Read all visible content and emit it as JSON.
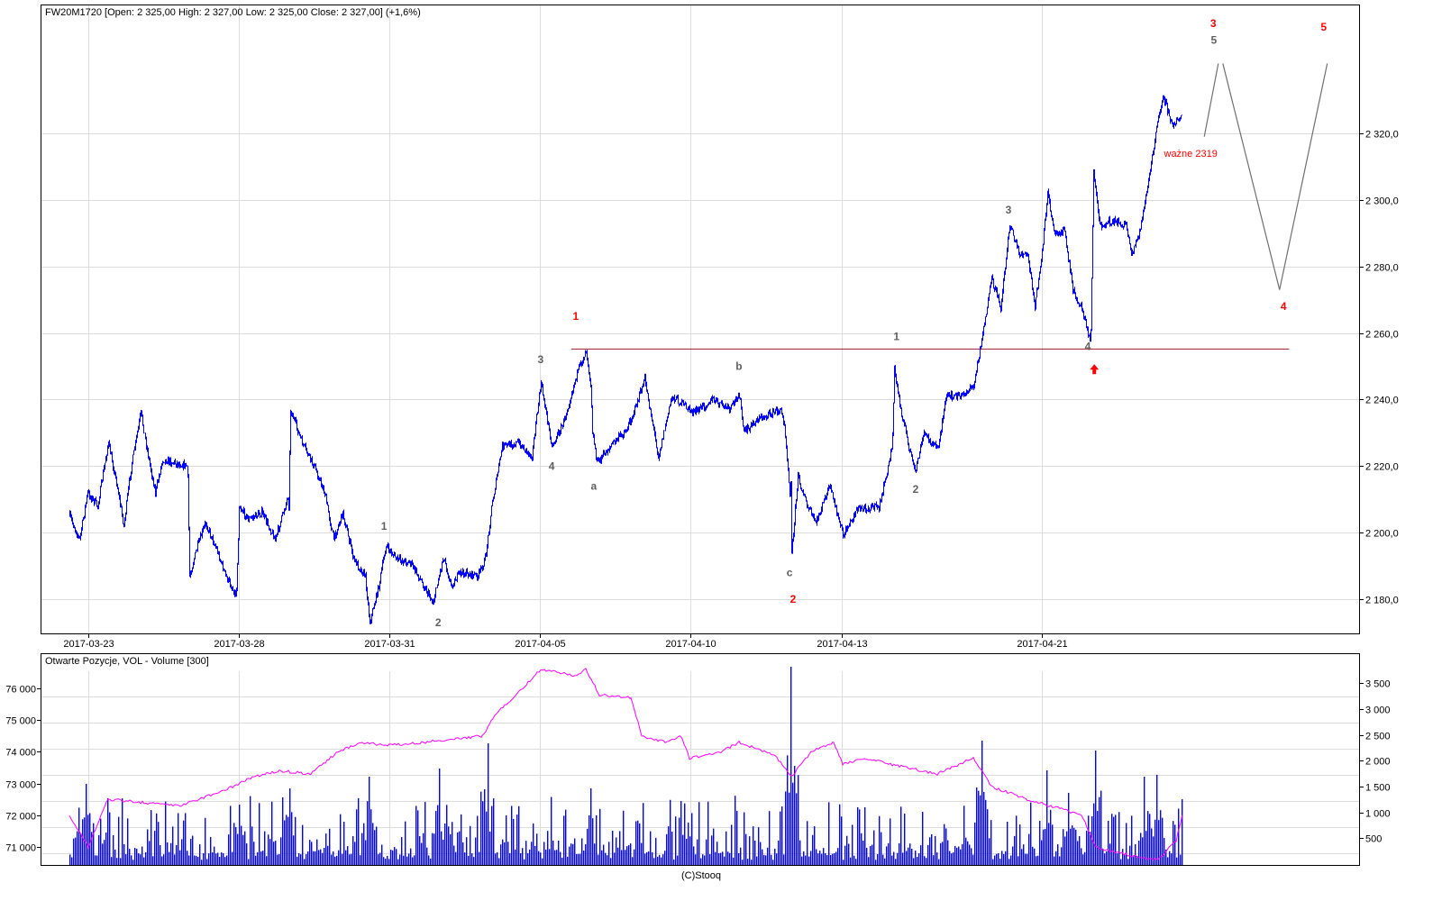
{
  "chart_data": [
    {
      "type": "line",
      "title": "FW20M1720 [Open: 2 325,00  High: 2 327,00  Low: 2 325,00  Close: 2 327,00] (+1,6%)",
      "x_unit": "trading days since 2017-03-23",
      "x_ticks": [
        {
          "d": 0,
          "label": "2017-03-23"
        },
        {
          "d": 3,
          "label": "2017-03-28"
        },
        {
          "d": 6,
          "label": "2017-03-31"
        },
        {
          "d": 9,
          "label": "2017-04-05"
        },
        {
          "d": 12,
          "label": "2017-04-10"
        },
        {
          "d": 15,
          "label": "2017-04-13"
        },
        {
          "d": 19,
          "label": "2017-04-21"
        }
      ],
      "y_ticks": [
        {
          "v": 2180,
          "label": "2 180,0"
        },
        {
          "v": 2200,
          "label": "2 200,0"
        },
        {
          "v": 2220,
          "label": "2 220,0"
        },
        {
          "v": 2240,
          "label": "2 240,0"
        },
        {
          "v": 2260,
          "label": "2 260,0"
        },
        {
          "v": 2280,
          "label": "2 280,0"
        },
        {
          "v": 2300,
          "label": "2 300,0"
        },
        {
          "v": 2320,
          "label": "2 320,0"
        }
      ],
      "ylim": [
        2169,
        2364
      ],
      "xlim": [
        -0.8,
        25.4
      ],
      "grid": true,
      "price_color": "#0000ff",
      "series": [
        {
          "name": "FW20M1720",
          "points": [
            [
              -0.38,
              2205
            ],
            [
              -0.18,
              2198
            ],
            [
              -0.02,
              2212
            ],
            [
              0.18,
              2208
            ],
            [
              0.39,
              2227
            ],
            [
              0.57,
              2214
            ],
            [
              0.7,
              2202
            ],
            [
              0.84,
              2219
            ],
            [
              1.04,
              2236
            ],
            [
              1.2,
              2222
            ],
            [
              1.33,
              2212
            ],
            [
              1.47,
              2222
            ],
            [
              1.97,
              2220
            ],
            [
              2.01,
              2187
            ],
            [
              2.15,
              2195
            ],
            [
              2.33,
              2203
            ],
            [
              2.55,
              2195
            ],
            [
              2.73,
              2187
            ],
            [
              2.94,
              2181
            ],
            [
              3.0,
              2208
            ],
            [
              3.18,
              2204
            ],
            [
              3.45,
              2206
            ],
            [
              3.72,
              2198
            ],
            [
              3.99,
              2212
            ],
            [
              4.02,
              2237
            ],
            [
              4.25,
              2227
            ],
            [
              4.52,
              2219
            ],
            [
              4.7,
              2212
            ],
            [
              4.88,
              2198
            ],
            [
              5.06,
              2206
            ],
            [
              5.28,
              2192
            ],
            [
              5.51,
              2187
            ],
            [
              5.6,
              2173
            ],
            [
              5.78,
              2184
            ],
            [
              5.92,
              2196
            ],
            [
              6.14,
              2192
            ],
            [
              6.41,
              2191
            ],
            [
              6.68,
              2184
            ],
            [
              6.86,
              2179
            ],
            [
              7.07,
              2193
            ],
            [
              7.22,
              2184
            ],
            [
              7.4,
              2188
            ],
            [
              7.76,
              2187
            ],
            [
              7.9,
              2192
            ],
            [
              8.03,
              2208
            ],
            [
              8.24,
              2226
            ],
            [
              8.56,
              2227
            ],
            [
              8.83,
              2223
            ],
            [
              9.01,
              2245
            ],
            [
              9.23,
              2226
            ],
            [
              9.46,
              2233
            ],
            [
              9.69,
              2246
            ],
            [
              9.91,
              2255
            ],
            [
              10.0,
              2245
            ],
            [
              10.04,
              2230
            ],
            [
              10.13,
              2221
            ],
            [
              10.45,
              2227
            ],
            [
              10.72,
              2231
            ],
            [
              10.9,
              2238
            ],
            [
              11.08,
              2246
            ],
            [
              11.35,
              2223
            ],
            [
              11.62,
              2241
            ],
            [
              12.06,
              2236
            ],
            [
              12.42,
              2240
            ],
            [
              12.78,
              2237
            ],
            [
              12.96,
              2242
            ],
            [
              13.05,
              2230
            ],
            [
              13.32,
              2234
            ],
            [
              13.77,
              2237
            ],
            [
              13.86,
              2233
            ],
            [
              13.99,
              2208
            ],
            [
              14.0,
              2193
            ],
            [
              14.13,
              2217
            ],
            [
              14.31,
              2208
            ],
            [
              14.49,
              2203
            ],
            [
              14.76,
              2214
            ],
            [
              15.03,
              2199
            ],
            [
              15.3,
              2207
            ],
            [
              15.75,
              2208
            ],
            [
              15.92,
              2219
            ],
            [
              16.01,
              2227
            ],
            [
              16.05,
              2249
            ],
            [
              16.19,
              2236
            ],
            [
              16.46,
              2218
            ],
            [
              16.64,
              2230
            ],
            [
              16.91,
              2225
            ],
            [
              17.09,
              2241
            ],
            [
              17.36,
              2241
            ],
            [
              17.63,
              2244
            ],
            [
              17.81,
              2260
            ],
            [
              17.99,
              2276
            ],
            [
              18.17,
              2268
            ],
            [
              18.35,
              2293
            ],
            [
              18.53,
              2284
            ],
            [
              18.71,
              2283
            ],
            [
              18.85,
              2268
            ],
            [
              18.98,
              2282
            ],
            [
              19.1,
              2302
            ],
            [
              19.25,
              2290
            ],
            [
              19.43,
              2291
            ],
            [
              19.61,
              2273
            ],
            [
              19.79,
              2267
            ],
            [
              19.96,
              2257
            ],
            [
              20.02,
              2309
            ],
            [
              20.14,
              2292
            ],
            [
              20.41,
              2294
            ],
            [
              20.68,
              2292
            ],
            [
              20.77,
              2283
            ],
            [
              20.94,
              2291
            ],
            [
              21.12,
              2306
            ],
            [
              21.27,
              2321
            ],
            [
              21.4,
              2332
            ],
            [
              21.58,
              2322
            ],
            [
              21.79,
              2326
            ]
          ]
        }
      ],
      "projection": {
        "color": "#707070",
        "segments": [
          [
            [
              22.23,
              2319
            ],
            [
              22.51,
              2341
            ]
          ],
          [
            [
              22.6,
              2341
            ],
            [
              23.73,
              2273
            ]
          ],
          [
            [
              23.73,
              2273
            ],
            [
              24.68,
              2341
            ]
          ]
        ]
      },
      "resistance_line": {
        "price": 2255.3,
        "from_d": 9.62,
        "to_d": 23.92,
        "color": "#9b1c2c"
      },
      "annotations": [
        {
          "text": "1",
          "d": 9.71,
          "p": 2265,
          "color": "#ff0000"
        },
        {
          "text": "3",
          "d": 9.01,
          "p": 2252,
          "color": "#606060"
        },
        {
          "text": "4",
          "d": 9.23,
          "p": 2220,
          "color": "#606060"
        },
        {
          "text": "a",
          "d": 10.07,
          "p": 2214,
          "color": "#606060"
        },
        {
          "text": "b",
          "d": 12.96,
          "p": 2250,
          "color": "#606060"
        },
        {
          "text": "c",
          "d": 13.97,
          "p": 2188,
          "color": "#606060"
        },
        {
          "text": "2",
          "d": 14.04,
          "p": 2180,
          "color": "#ff0000"
        },
        {
          "text": "1",
          "d": 5.89,
          "p": 2202,
          "color": "#606060"
        },
        {
          "text": "2",
          "d": 6.97,
          "p": 2173,
          "color": "#606060"
        },
        {
          "text": "1",
          "d": 16.1,
          "p": 2259,
          "color": "#606060"
        },
        {
          "text": "2",
          "d": 16.48,
          "p": 2213,
          "color": "#606060"
        },
        {
          "text": "3",
          "d": 18.33,
          "p": 2297,
          "color": "#606060"
        },
        {
          "text": "4",
          "d": 19.91,
          "p": 2256,
          "color": "#606060"
        },
        {
          "text": "3",
          "d": 22.41,
          "p": 2353,
          "color": "#ff0000"
        },
        {
          "text": "5",
          "d": 22.42,
          "p": 2348,
          "color": "#606060"
        },
        {
          "text": "5",
          "d": 24.61,
          "p": 2352,
          "color": "#ff0000"
        },
        {
          "text": "4",
          "d": 23.81,
          "p": 2268,
          "color": "#ff0000"
        }
      ],
      "note": {
        "text": "ważne 2319",
        "d": 21.96,
        "p": 2314,
        "color": "#ff0000"
      },
      "arrow": {
        "icon": "arrow-up-icon",
        "d": 20.04,
        "p": 2249,
        "color": "#ff0000"
      }
    },
    {
      "type": "bar",
      "title": "Otwarte Pozycje, VOL - Volume [300]",
      "left_axis_ticks": [
        {
          "v": 71000,
          "label": "71 000"
        },
        {
          "v": 72000,
          "label": "72 000"
        },
        {
          "v": 73000,
          "label": "73 000"
        },
        {
          "v": 74000,
          "label": "74 000"
        },
        {
          "v": 75000,
          "label": "75 000"
        },
        {
          "v": 76000,
          "label": "76 000"
        }
      ],
      "right_axis_ticks": [
        {
          "v": 500,
          "label": "500"
        },
        {
          "v": 1000,
          "label": "1 000"
        },
        {
          "v": 1500,
          "label": "1 500"
        },
        {
          "v": 2000,
          "label": "2 000"
        },
        {
          "v": 2500,
          "label": "2 500"
        },
        {
          "v": 3000,
          "label": "3 000"
        },
        {
          "v": 3500,
          "label": "3 500"
        }
      ],
      "volume_color": "#0000ff",
      "oi_color": "#ff00ff",
      "open_interest": [
        [
          -0.38,
          72000
        ],
        [
          0,
          71000
        ],
        [
          0.39,
          72500
        ],
        [
          1.83,
          72300
        ],
        [
          2.73,
          72800
        ],
        [
          3.27,
          73200
        ],
        [
          3.81,
          73400
        ],
        [
          4.43,
          73300
        ],
        [
          4.97,
          74000
        ],
        [
          5.42,
          74300
        ],
        [
          5.96,
          74200
        ],
        [
          6.68,
          74300
        ],
        [
          7.22,
          74400
        ],
        [
          7.85,
          74500
        ],
        [
          8.12,
          75200
        ],
        [
          8.65,
          76000
        ],
        [
          9.01,
          76600
        ],
        [
          9.73,
          76400
        ],
        [
          9.91,
          76600
        ],
        [
          10.18,
          75800
        ],
        [
          10.81,
          75700
        ],
        [
          11.03,
          74500
        ],
        [
          11.53,
          74300
        ],
        [
          11.8,
          74500
        ],
        [
          11.98,
          73800
        ],
        [
          12.6,
          74000
        ],
        [
          12.96,
          74300
        ],
        [
          13.68,
          73900
        ],
        [
          14.0,
          73200
        ],
        [
          14.4,
          74000
        ],
        [
          14.85,
          74300
        ],
        [
          15.03,
          73600
        ],
        [
          15.48,
          73800
        ],
        [
          16.01,
          73600
        ],
        [
          16.91,
          73300
        ],
        [
          17.63,
          73800
        ],
        [
          17.99,
          72900
        ],
        [
          18.71,
          72500
        ],
        [
          19.79,
          72000
        ],
        [
          20.06,
          71000
        ],
        [
          20.83,
          70700
        ],
        [
          21.31,
          70600
        ],
        [
          21.67,
          71200
        ],
        [
          21.79,
          72000
        ]
      ],
      "volume_spikes": [
        [
          13.99,
          3822
        ],
        [
          7.95,
          2339
        ],
        [
          17.79,
          2390
        ],
        [
          20.04,
          2200
        ],
        [
          19.07,
          1815
        ],
        [
          -0.05,
          1553
        ],
        [
          7.0,
          1850
        ],
        [
          5.57,
          1693
        ],
        [
          3.99,
          1466
        ],
        [
          10.0,
          1466
        ],
        [
          21.04,
          1693
        ],
        [
          21.26,
          1728
        ],
        [
          19.53,
          1380
        ],
        [
          3.0,
          1151
        ]
      ]
    }
  ],
  "footer": {
    "copyright": "(C)Stooq"
  }
}
